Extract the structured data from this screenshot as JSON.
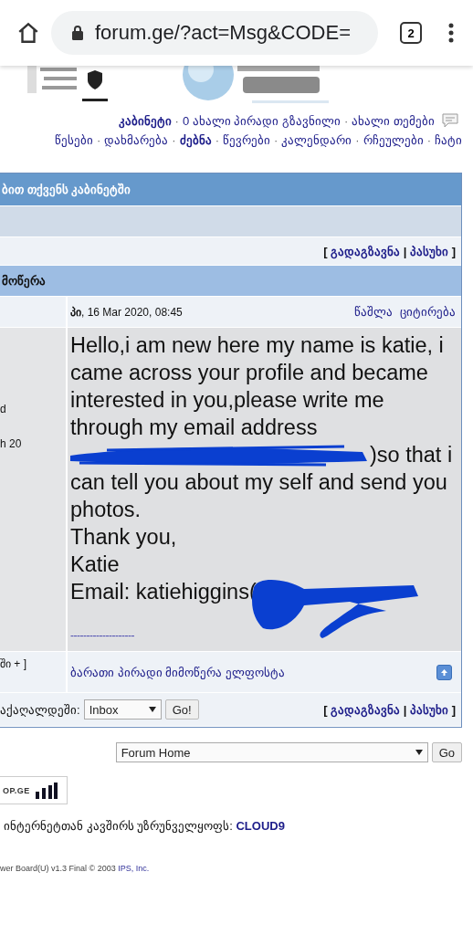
{
  "browser": {
    "url": "forum.ge/?act=Msg&CODE=",
    "tab_count": "2"
  },
  "nav": {
    "separator": "·",
    "lines": [
      {
        "links": [
          {
            "label": "კაბინეტი",
            "bold": true
          },
          {
            "label": "0 ახალი პირადი გზავნილი",
            "bold": false
          },
          {
            "label": "ახალი თემები",
            "bold": false
          }
        ]
      },
      {
        "links": [
          {
            "label": "წესები",
            "bold": false
          },
          {
            "label": "დახმარება",
            "bold": false
          },
          {
            "label": "ძებნა",
            "bold": true
          },
          {
            "label": "წევრები",
            "bold": false
          },
          {
            "label": "კალენდარი",
            "bold": false
          },
          {
            "label": "რჩეულები",
            "bold": false
          },
          {
            "label": "ჩატი",
            "bold": false
          }
        ]
      }
    ]
  },
  "panel": {
    "title": "ბით თქვენს კაბინეტში",
    "actions_top": {
      "open": "[",
      "separator": "|",
      "close": "]",
      "links": [
        {
          "label": "გადაგზავნა"
        },
        {
          "label": "პასუხი"
        }
      ]
    },
    "subtitle": "მოწერა",
    "message": {
      "date_prefix": "პი",
      "date": ", 16 Mar 2020, 08:45",
      "links": [
        {
          "label": "წაშლა"
        },
        {
          "label": "ციტირება"
        }
      ],
      "side_lines": [
        "d",
        "h 20"
      ],
      "paragraphs": [
        [
          {
            "kind": "text",
            "text": "Hello,i am new here my name is katie, i came across your profile and became interested in you,please write me through my email address"
          },
          {
            "kind": "redaction",
            "after": ")so that i"
          },
          {
            "kind": "text",
            "text": "can tell you about my self and send you photos."
          }
        ],
        [
          {
            "kind": "text",
            "text": "Thank you,"
          }
        ],
        [
          {
            "kind": "text",
            "text": "Katie"
          }
        ],
        [
          {
            "kind": "text",
            "text": "Email: katiehiggins("
          },
          {
            "kind": "scribble"
          }
        ]
      ],
      "signature": "--------------------"
    },
    "footer_side": "ში + ]",
    "footer_link": "ბარათი პირადი მიმოწერა ელფოსტა",
    "move_label": "აქაღალდეში:",
    "folder": "Inbox",
    "go": "Go!",
    "actions_bottom": {
      "open": "[",
      "separator": "|",
      "close": "]",
      "links": [
        {
          "label": "გადაგზავნა"
        },
        {
          "label": "პასუხი"
        }
      ]
    }
  },
  "jump": {
    "value": "Forum Home",
    "go": "Go"
  },
  "counter": "OP.GE",
  "provider": {
    "text": "ინტერნეტთან კავშირს უზრუნველყოფს: ",
    "link": "CLOUD9"
  },
  "copyright": {
    "text": "wer Board(U) v1.3 Final © 2003",
    "link": "IPS, Inc."
  }
}
